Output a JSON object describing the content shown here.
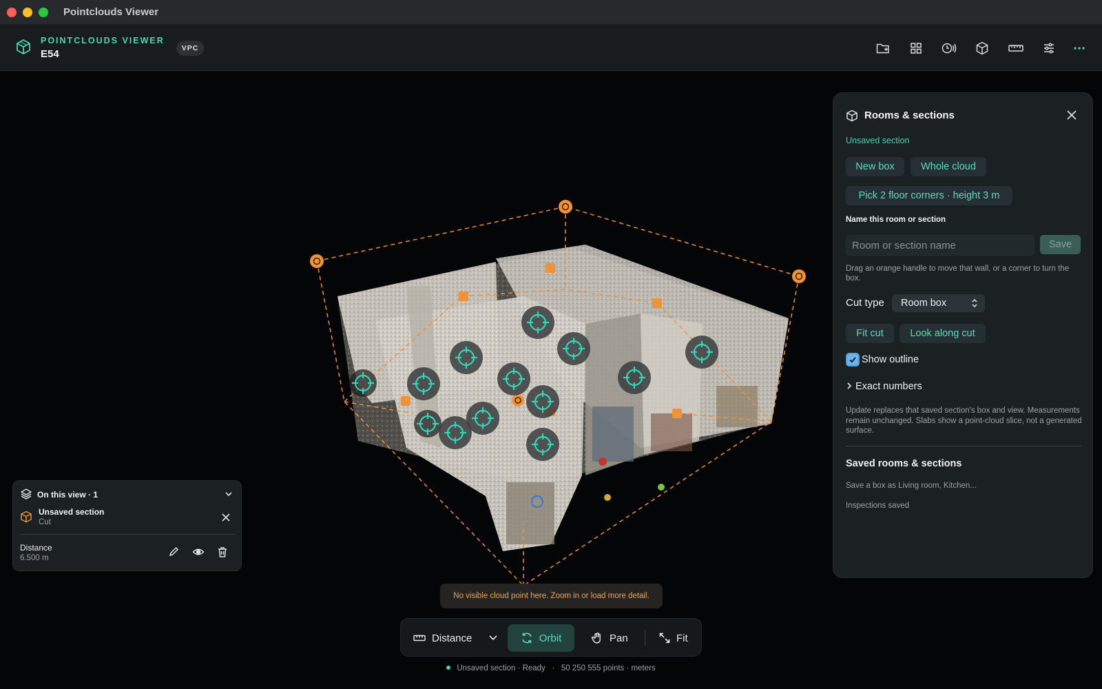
{
  "window": {
    "title": "Pointclouds Viewer"
  },
  "header": {
    "brand": "POINTCLOUDS VIEWER",
    "project": "E54",
    "badge": "VPC",
    "toolbar_icons": [
      "folder-plus-icon",
      "grid-icon",
      "scan-icon",
      "cube-icon",
      "ruler-icon",
      "sliders-icon",
      "more-icon"
    ]
  },
  "panel": {
    "title": "Rooms & sections",
    "status": "Unsaved section",
    "new_box": "New box",
    "whole_cloud": "Whole cloud",
    "pick_corners": "Pick 2 floor corners · height 3 m",
    "name_label": "Name this room or section",
    "name_placeholder": "Room or section name",
    "save": "Save",
    "drag_hint": "Drag an orange handle to move that wall, or a corner to turn the box.",
    "cut_type_label": "Cut type",
    "cut_type_value": "Room box",
    "fit_cut": "Fit cut",
    "look_along": "Look along cut",
    "show_outline": "Show outline",
    "show_outline_checked": true,
    "exact_numbers": "Exact numbers",
    "update_note": "Update replaces that saved section's box and view. Measurements remain unchanged. Slabs show a point-cloud slice, not a generated surface.",
    "saved_title": "Saved rooms & sections",
    "saved_hint": "Save a box as Living room, Kitchen...",
    "inspections": "Inspections saved"
  },
  "view_panel": {
    "title": "On this view · 1",
    "section_name": "Unsaved section",
    "section_kind": "Cut",
    "measure_name": "Distance",
    "measure_value": "6.500 m"
  },
  "toast": "No visible cloud point here. Zoom in or load more detail.",
  "dock": {
    "tool": "Distance",
    "orbit": "Orbit",
    "pan": "Pan",
    "fit": "Fit",
    "active": "Orbit"
  },
  "status": {
    "state": "Unsaved section · Ready",
    "sep": "·",
    "points": "50 250 555 points · meters"
  },
  "colors": {
    "accent": "#54d3b5",
    "handle": "#f0923a",
    "panel": "#1b2023",
    "warning": "#f2a347"
  }
}
